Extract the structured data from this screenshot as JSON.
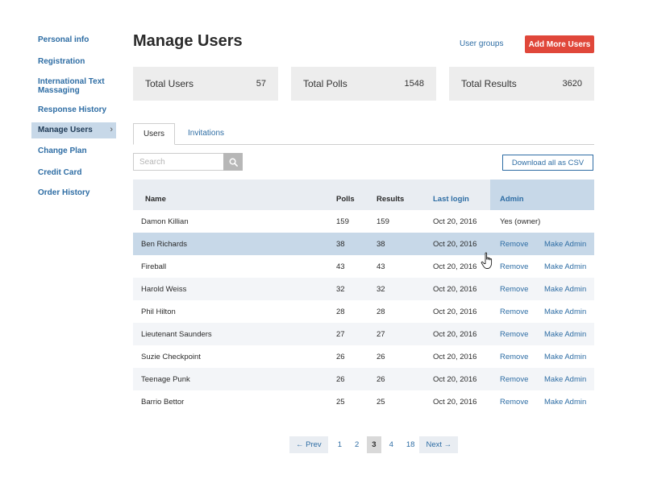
{
  "sidebar": {
    "items": [
      {
        "label": "Personal info"
      },
      {
        "label": "Registration"
      },
      {
        "label": "International Text Massaging"
      },
      {
        "label": "Response History"
      },
      {
        "label": "Manage Users",
        "active": true
      },
      {
        "label": "Change Plan"
      },
      {
        "label": "Credit Card"
      },
      {
        "label": "Order History"
      }
    ]
  },
  "header": {
    "title": "Manage Users",
    "user_groups": "User groups",
    "add_button": "Add More Users"
  },
  "stats": [
    {
      "label": "Total Users",
      "value": "57"
    },
    {
      "label": "Total Polls",
      "value": "1548"
    },
    {
      "label": "Total Results",
      "value": "3620"
    }
  ],
  "tabs": [
    {
      "label": "Users",
      "active": true
    },
    {
      "label": "Invitations"
    }
  ],
  "search": {
    "placeholder": "Search"
  },
  "download_label": "Download all as CSV",
  "table": {
    "headers": {
      "name": "Name",
      "polls": "Polls",
      "results": "Results",
      "login": "Last login",
      "admin": "Admin"
    },
    "rows": [
      {
        "name": "Damon Killian",
        "polls": "159",
        "results": "159",
        "login": "Oct 20, 2016",
        "owner": "Yes (owner)"
      },
      {
        "name": "Ben Richards",
        "polls": "38",
        "results": "38",
        "login": "Oct 20, 2016",
        "remove": "Remove",
        "make": "Make Admin"
      },
      {
        "name": "Fireball",
        "polls": "43",
        "results": "43",
        "login": "Oct 20, 2016",
        "remove": "Remove",
        "make": "Make Admin"
      },
      {
        "name": "Harold Weiss",
        "polls": "32",
        "results": "32",
        "login": "Oct 20, 2016",
        "remove": "Remove",
        "make": "Make Admin"
      },
      {
        "name": "Phil Hilton",
        "polls": "28",
        "results": "28",
        "login": "Oct 20, 2016",
        "remove": "Remove",
        "make": "Make Admin"
      },
      {
        "name": "Lieutenant Saunders",
        "polls": "27",
        "results": "27",
        "login": "Oct 20, 2016",
        "remove": "Remove",
        "make": "Make Admin"
      },
      {
        "name": "Suzie Checkpoint",
        "polls": "26",
        "results": "26",
        "login": "Oct 20, 2016",
        "remove": "Remove",
        "make": "Make Admin"
      },
      {
        "name": "Teenage Punk",
        "polls": "26",
        "results": "26",
        "login": "Oct 20, 2016",
        "remove": "Remove",
        "make": "Make Admin"
      },
      {
        "name": "Barrio Bettor",
        "polls": "25",
        "results": "25",
        "login": "Oct 20, 2016",
        "remove": "Remove",
        "make": "Make Admin"
      }
    ]
  },
  "pagination": {
    "prev": "← Prev",
    "pages": [
      "1",
      "2",
      "3",
      "4",
      "18"
    ],
    "current": "3",
    "next": "Next →"
  },
  "colors": {
    "accent": "#2e6da4",
    "danger": "#e0473a",
    "selected": "#c7d8e8"
  }
}
